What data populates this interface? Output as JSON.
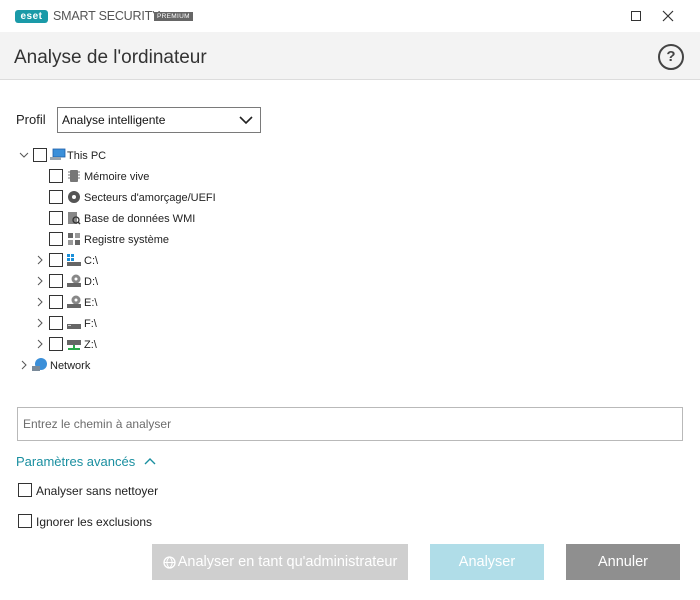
{
  "titlebar": {
    "logo_text": "eset",
    "app_name": "SMART SECURITY",
    "badge": "PREMIUM"
  },
  "header": {
    "title": "Analyse de l'ordinateur",
    "help_icon_text": "?"
  },
  "profile": {
    "label": "Profil",
    "selected": "Analyse intelligente"
  },
  "tree": {
    "root": "This PC",
    "items": [
      {
        "label": "Mémoire vive",
        "icon": "memory-icon"
      },
      {
        "label": "Secteurs d'amorçage/UEFI",
        "icon": "disc-icon"
      },
      {
        "label": "Base de données WMI",
        "icon": "wmi-icon"
      },
      {
        "label": "Registre système",
        "icon": "registry-icon"
      }
    ],
    "drives": [
      {
        "label": "C:\\",
        "icon": "windows-drive-icon"
      },
      {
        "label": "D:\\",
        "icon": "cd-drive-icon"
      },
      {
        "label": "E:\\",
        "icon": "cd-drive-icon"
      },
      {
        "label": "F:\\",
        "icon": "drive-icon"
      },
      {
        "label": "Z:\\",
        "icon": "network-drive-icon"
      }
    ],
    "network": "Network"
  },
  "path_input": {
    "placeholder": "Entrez le chemin à analyser"
  },
  "advanced": {
    "label": "Paramètres avancés",
    "options": [
      {
        "label": "Analyser sans nettoyer"
      },
      {
        "label": "Ignorer les exclusions"
      }
    ]
  },
  "buttons": {
    "admin": "Analyser en tant qu'administrateur",
    "scan": "Analyser",
    "cancel": "Annuler"
  },
  "colors": {
    "accent": "#1a8fa0",
    "scan_button_disabled": "#b0dde8",
    "admin_button_disabled": "#cfcfcf",
    "cancel_button": "#8f8f8f"
  }
}
